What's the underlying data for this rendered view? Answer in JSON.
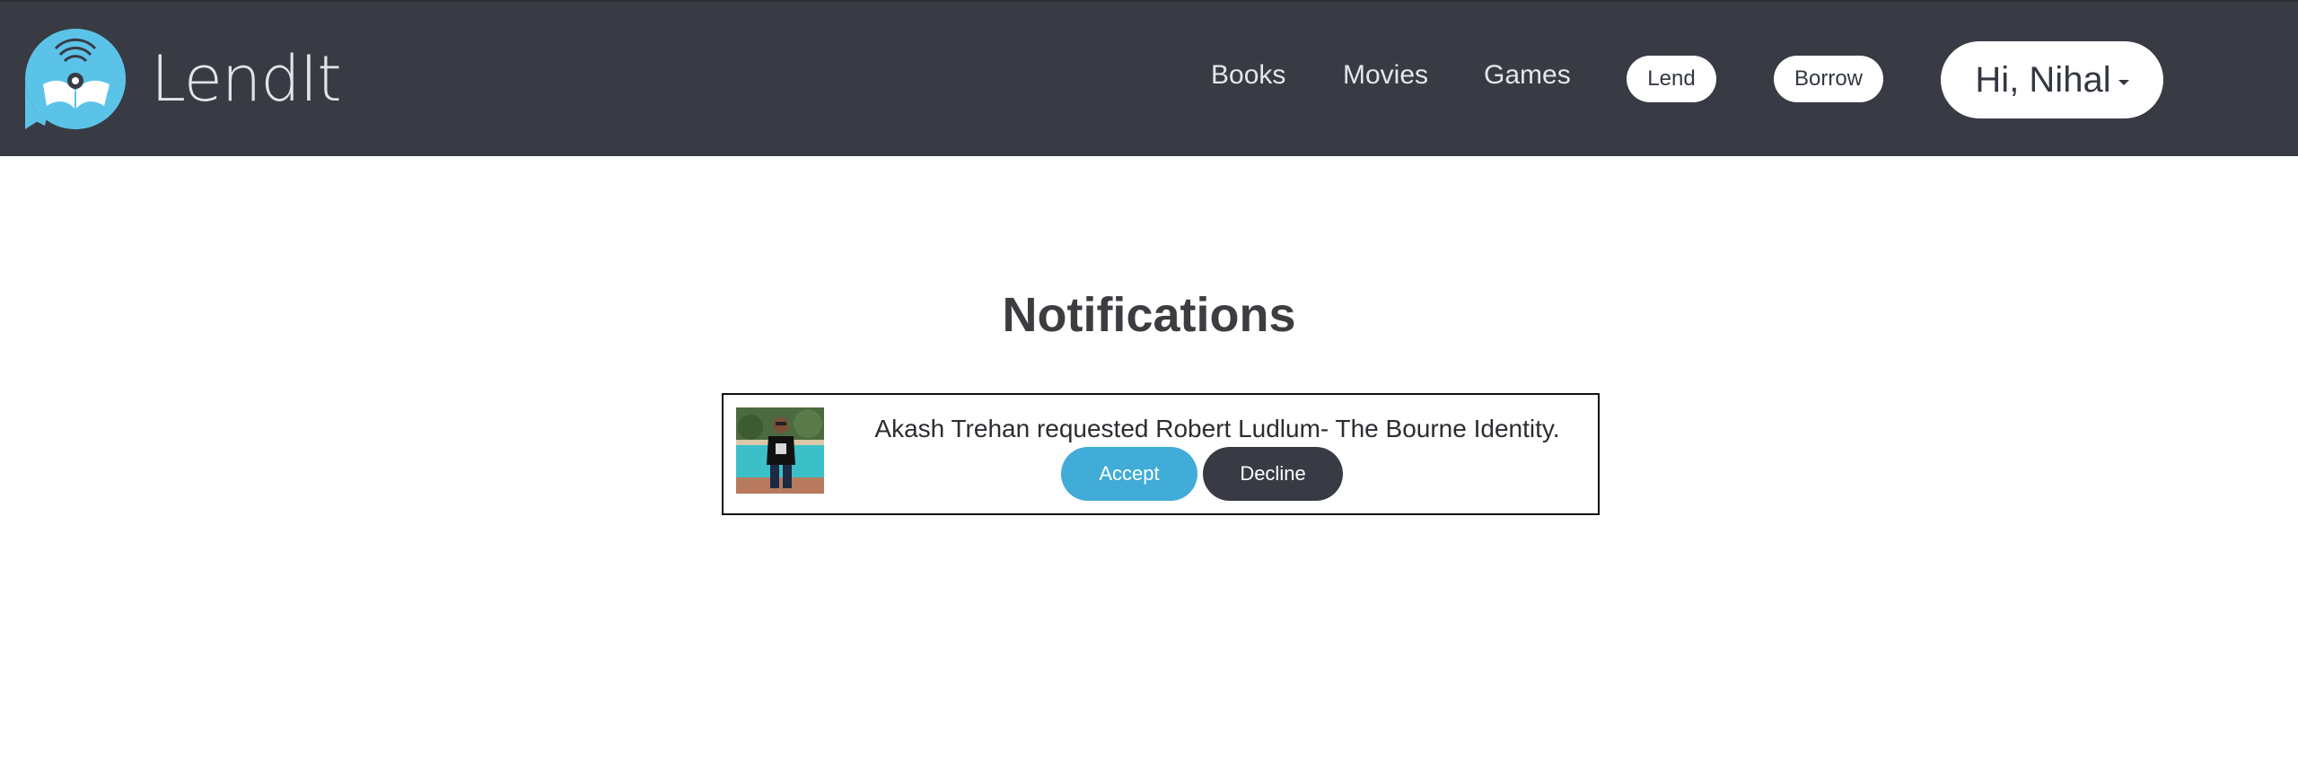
{
  "brand": {
    "name": "LendIt",
    "accent": "#5cc3e8"
  },
  "nav": {
    "links": [
      "Books",
      "Movies",
      "Games"
    ],
    "lend_label": "Lend",
    "borrow_label": "Borrow",
    "user_greeting": "Hi, Nihal"
  },
  "main": {
    "title": "Notifications",
    "notifications": [
      {
        "message": "Akash Trehan requested Robert Ludlum- The Bourne Identity.",
        "accept_label": "Accept",
        "decline_label": "Decline"
      }
    ]
  },
  "colors": {
    "navbar": "#383b44",
    "accept": "#40acd7",
    "decline": "#383b44"
  }
}
